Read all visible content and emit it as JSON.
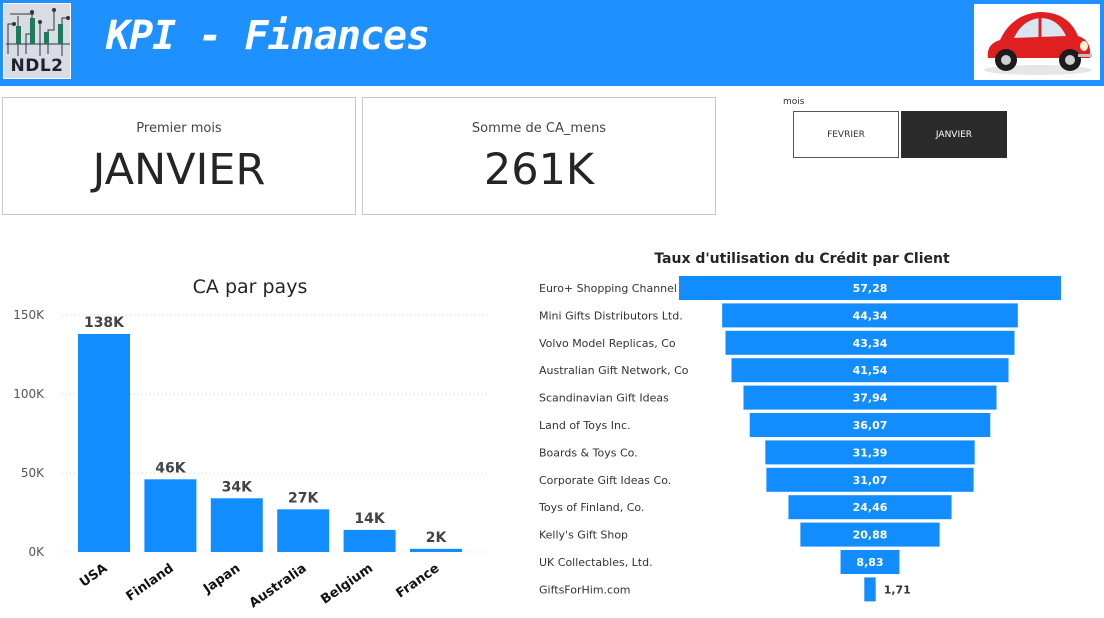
{
  "header": {
    "logo_text": "NDL2",
    "title": "KPI - Finances",
    "car_image": "red-beetle-car"
  },
  "kpis": [
    {
      "label": "Premier mois",
      "value": "JANVIER"
    },
    {
      "label": "Somme de CA_mens",
      "value": "261K"
    }
  ],
  "slicer": {
    "label": "mois",
    "options": [
      {
        "label": "FEVRIER",
        "selected": false
      },
      {
        "label": "JANVIER",
        "selected": true
      }
    ]
  },
  "colors": {
    "accent": "#1e90ff",
    "bar": "#118dff",
    "slicer_selected": "#2b2b2b"
  },
  "chart_data": [
    {
      "type": "bar",
      "title": "CA par pays",
      "categories": [
        "USA",
        "Finland",
        "Japan",
        "Australia",
        "Belgium",
        "France"
      ],
      "values": [
        138000,
        46000,
        34000,
        27000,
        14000,
        2000
      ],
      "data_labels": [
        "138K",
        "46K",
        "34K",
        "27K",
        "14K",
        "2K"
      ],
      "y_ticks": [
        {
          "value": 0,
          "label": "0K"
        },
        {
          "value": 50000,
          "label": "50K"
        },
        {
          "value": 100000,
          "label": "100K"
        },
        {
          "value": 150000,
          "label": "150K"
        }
      ],
      "ylim": [
        0,
        150000
      ],
      "grid": true
    },
    {
      "type": "funnel",
      "title": "Taux d'utilisation du Crédit par Client",
      "categories": [
        "Euro+ Shopping Channel",
        "Mini Gifts Distributors Ltd.",
        "Volvo Model Replicas, Co",
        "Australian Gift Network, Co",
        "Scandinavian Gift Ideas",
        "Land of Toys Inc.",
        "Boards & Toys Co.",
        "Corporate Gift Ideas Co.",
        "Toys of Finland, Co.",
        "Kelly's Gift Shop",
        "UK Collectables, Ltd.",
        "GiftsForHim.com"
      ],
      "values": [
        57.28,
        44.34,
        43.34,
        41.54,
        37.94,
        36.07,
        31.39,
        31.07,
        24.46,
        20.88,
        8.83,
        1.71
      ],
      "data_labels": [
        "57,28",
        "44,34",
        "43,34",
        "41,54",
        "37,94",
        "36,07",
        "31,39",
        "31,07",
        "24,46",
        "20,88",
        "8,83",
        "1,71"
      ]
    }
  ]
}
